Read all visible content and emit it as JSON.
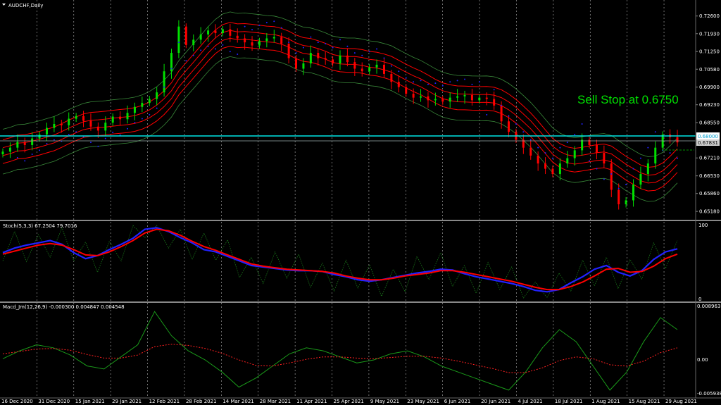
{
  "chart_title": "AUDCHF​,Daily",
  "main_panel": {
    "y_ticks": [
      "0.72600",
      "0.71930",
      "0.71250",
      "0.70580",
      "0.69900",
      "0.69230",
      "0.68550",
      "0.67210",
      "0.66530",
      "0.65860",
      "0.65180"
    ],
    "y_range": [
      0.6505,
      0.7278
    ],
    "price_box_label": "0.68000",
    "price_box_value": 0.68,
    "current_price_label": "0.67831",
    "current_price_value": 0.67831,
    "annotation": "Sell Stop at 0.6750",
    "colors": {
      "bull": "#00e000",
      "bear": "#ff0000",
      "bands": "#ff0000",
      "outer": "#3a8a3a",
      "sar": "#2222ff",
      "cyan_line": "#00e5e5"
    }
  },
  "stoch_panel": {
    "header": "Stoch(5,3,3) 67.2504 79.7016",
    "y_ticks": [
      "100",
      "0"
    ],
    "colors": {
      "main": "#2222ff",
      "signal": "#ff0000",
      "raw": "#1a7a1a"
    }
  },
  "macd_panel": {
    "header": "Macd_Jm(12,26,9) -0.000300 0.004847 0.004548",
    "y_ticks": [
      "0.008963",
      "0.00",
      "-0.005938"
    ],
    "colors": {
      "macd": "#1a9a1a",
      "signal": "#ff2020"
    }
  },
  "x_axis": {
    "labels": [
      "16 Dec 2020",
      "31 Dec 2020",
      "15 Jan 2021",
      "29 Jan 2021",
      "12 Feb 2021",
      "28 Feb 2021",
      "14 Mar 2021",
      "28 Mar 2021",
      "11 Apr 2021",
      "25 Apr 2021",
      "9 May 2021",
      "23 May 2021",
      "6 Jun 2021",
      "20 Jun 2021",
      "4 Jul 2021",
      "18 Jul 2021",
      "1 Aug 2021",
      "15 Aug 2021",
      "29 Aug 2021"
    ]
  },
  "chart_data": {
    "type": "candlestick",
    "symbol": "AUDCHF",
    "timeframe": "Daily",
    "close_series": [
      0.6745,
      0.676,
      0.6782,
      0.677,
      0.6795,
      0.681,
      0.6835,
      0.685,
      0.6845,
      0.687,
      0.688,
      0.6862,
      0.684,
      0.6825,
      0.6855,
      0.6878,
      0.6868,
      0.6892,
      0.6915,
      0.693,
      0.6945,
      0.697,
      0.705,
      0.712,
      0.722,
      0.715,
      0.717,
      0.719,
      0.7205,
      0.7195,
      0.721,
      0.7185,
      0.7175,
      0.716,
      0.7148,
      0.7165,
      0.7175,
      0.718,
      0.7155,
      0.71,
      0.706,
      0.708,
      0.712,
      0.71,
      0.7095,
      0.708,
      0.711,
      0.7085,
      0.706,
      0.705,
      0.7065,
      0.7075,
      0.704,
      0.701,
      0.699,
      0.6965,
      0.695,
      0.6955,
      0.694,
      0.6945,
      0.6935,
      0.695,
      0.6955,
      0.696,
      0.694,
      0.695,
      0.6945,
      0.692,
      0.686,
      0.682,
      0.679,
      0.676,
      0.673,
      0.67,
      0.668,
      0.666,
      0.67,
      0.672,
      0.675,
      0.679,
      0.677,
      0.674,
      0.67,
      0.66,
      0.6545,
      0.656,
      0.662,
      0.666,
      0.67,
      0.676,
      0.681,
      0.68,
      0.678
    ],
    "stoch_main_series": [
      62,
      68,
      72,
      75,
      78,
      73,
      62,
      54,
      58,
      66,
      73,
      81,
      93,
      95,
      90,
      82,
      75,
      66,
      63,
      57,
      51,
      45,
      43,
      41,
      39,
      38,
      38,
      37,
      33,
      30,
      26,
      24,
      26,
      29,
      32,
      35,
      37,
      40,
      39,
      34,
      30,
      27,
      24,
      21,
      17,
      12,
      10,
      13,
      22,
      30,
      40,
      45,
      36,
      31,
      38,
      53,
      63,
      67
    ],
    "stoch_signal_series": [
      60,
      64,
      68,
      72,
      74,
      72,
      66,
      59,
      58,
      63,
      70,
      78,
      88,
      93,
      91,
      85,
      77,
      70,
      65,
      59,
      53,
      47,
      44,
      42,
      40,
      39,
      38,
      37,
      35,
      31,
      28,
      26,
      26,
      28,
      31,
      33,
      35,
      38,
      38,
      36,
      33,
      30,
      27,
      24,
      20,
      16,
      13,
      13,
      17,
      23,
      31,
      40,
      41,
      36,
      37,
      44,
      54,
      60
    ],
    "macd_series": [
      0.0002,
      0.0015,
      0.0025,
      0.002,
      0.0008,
      -0.001,
      -0.0015,
      0.0005,
      0.0025,
      0.008,
      0.004,
      0.0015,
      0.0,
      -0.002,
      -0.0045,
      -0.003,
      -0.001,
      0.001,
      0.002,
      0.0015,
      0.0005,
      -0.0005,
      0.0,
      0.001,
      0.0015,
      0.0005,
      -0.001,
      -0.002,
      -0.003,
      -0.004,
      -0.005,
      -0.002,
      0.002,
      0.005,
      0.003,
      -0.001,
      -0.005,
      -0.002,
      0.003,
      0.007,
      0.005
    ],
    "macd_signal_series": [
      0.001,
      0.0014,
      0.0018,
      0.0019,
      0.0016,
      0.0009,
      0.0003,
      0.0003,
      0.0008,
      0.0022,
      0.0026,
      0.0024,
      0.0019,
      0.0011,
      0.0,
      -0.0009,
      -0.001,
      -0.0005,
      0.0001,
      0.0005,
      0.0005,
      0.0003,
      0.0002,
      0.0004,
      0.0006,
      0.0006,
      0.0003,
      -0.0002,
      -0.0008,
      -0.0014,
      -0.0021,
      -0.0021,
      -0.0013,
      -0.0001,
      0.0005,
      0.0002,
      -0.0008,
      -0.001,
      -0.0002,
      0.0012,
      0.002
    ]
  }
}
